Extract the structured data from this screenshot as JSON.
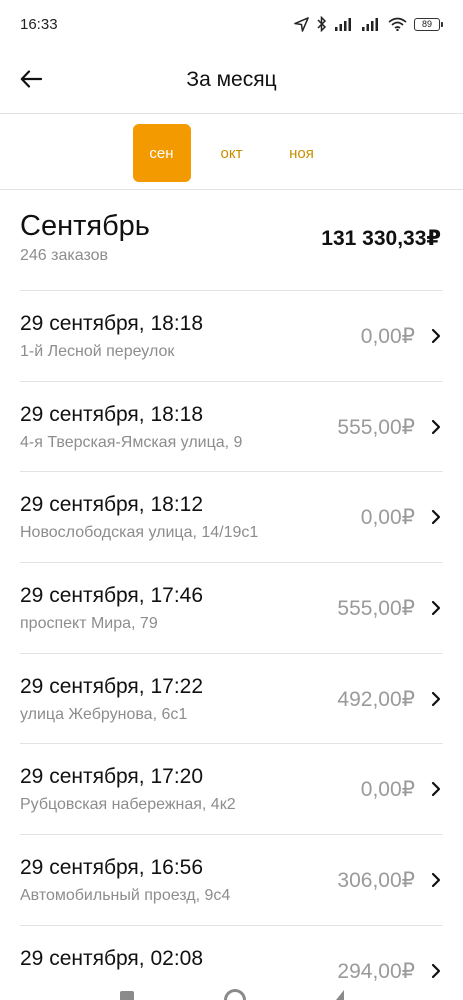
{
  "status_bar": {
    "time": "16:33",
    "battery": "89"
  },
  "header": {
    "title": "За месяц"
  },
  "month_tabs": [
    {
      "label": "сен",
      "active": true
    },
    {
      "label": "окт",
      "active": false
    },
    {
      "label": "ноя",
      "active": false
    }
  ],
  "summary": {
    "month": "Сентябрь",
    "orders_count": "246 заказов",
    "total": "131 330,33₽"
  },
  "orders": [
    {
      "date": "29 сентября, 18:18",
      "address": "1-й Лесной переулок",
      "amount": "0,00₽"
    },
    {
      "date": "29 сентября, 18:18",
      "address": "4-я Тверская-Ямская улица, 9",
      "amount": "555,00₽"
    },
    {
      "date": "29 сентября, 18:12",
      "address": "Новослободская улица, 14/19с1",
      "amount": "0,00₽"
    },
    {
      "date": "29 сентября, 17:46",
      "address": "проспект Мира, 79",
      "amount": "555,00₽"
    },
    {
      "date": "29 сентября, 17:22",
      "address": "улица Жебрунова, 6с1",
      "amount": "492,00₽"
    },
    {
      "date": "29 сентября, 17:20",
      "address": "Рубцовская набережная, 4к2",
      "amount": "0,00₽"
    },
    {
      "date": "29 сентября, 16:56",
      "address": "Автомобильный проезд, 9с4",
      "amount": "306,00₽"
    },
    {
      "date": "29 сентября, 02:08",
      "address": "",
      "amount": "294,00₽"
    }
  ]
}
